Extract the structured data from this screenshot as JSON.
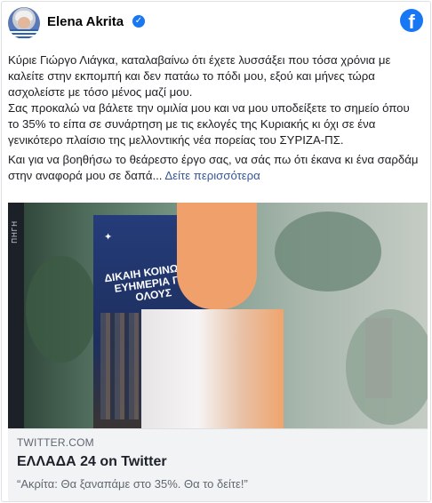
{
  "post": {
    "author": "Elena Akrita",
    "verified_icon": "verified-badge",
    "brand_icon": "facebook-logo",
    "brand_glyph": "f",
    "paragraph1": "Κύριε Γιώργο Λιάγκα, καταλαβαίνω ότι έχετε λυσσάξει που τόσα χρόνια με καλείτε στην εκπομπή και δεν πατάω το πόδι μου, εξού και μήνες τώρα ασχολείστε με τόσο μένος μαζί μου.",
    "paragraph2": "Σας προκαλώ να βάλετε την ομιλία μου και να μου υποδείξετε το σημείο όπου το 35% το είπα σε συνάρτηση με τις εκλογές της Κυριακής κι όχι σε ένα γενικότερο πλαίσιο της μελλοντικής νέα πορείας του ΣΥΡΙΖΑ-ΠΣ.",
    "paragraph3": "Και για να βοηθήσω το θεάρεστο έργο σας, να σάς πω ότι έκανα κι ένα σαρδάμ στην αναφορά μου σε δαπά...",
    "see_more": "Δείτε περισσότερα"
  },
  "media": {
    "side_caption": "ΠΗΓΗ",
    "poster_headline": "ΔΙΚΑΙΗ ΚΟΙΝΩΝΙΑ ΕΥΗΜΕΡΙΑ ΓΙΑ ΟΛΟΥΣ"
  },
  "link": {
    "domain": "TWITTER.COM",
    "title": "ΕΛΛΑΔΑ 24 on Twitter",
    "description": "“Ακρίτα: Θα ξαναπάμε στο 35%. Θα το δείτε!”"
  },
  "colors": {
    "facebook_blue": "#1877f2",
    "link_color": "#385898",
    "link_box_bg": "#f2f3f5"
  }
}
